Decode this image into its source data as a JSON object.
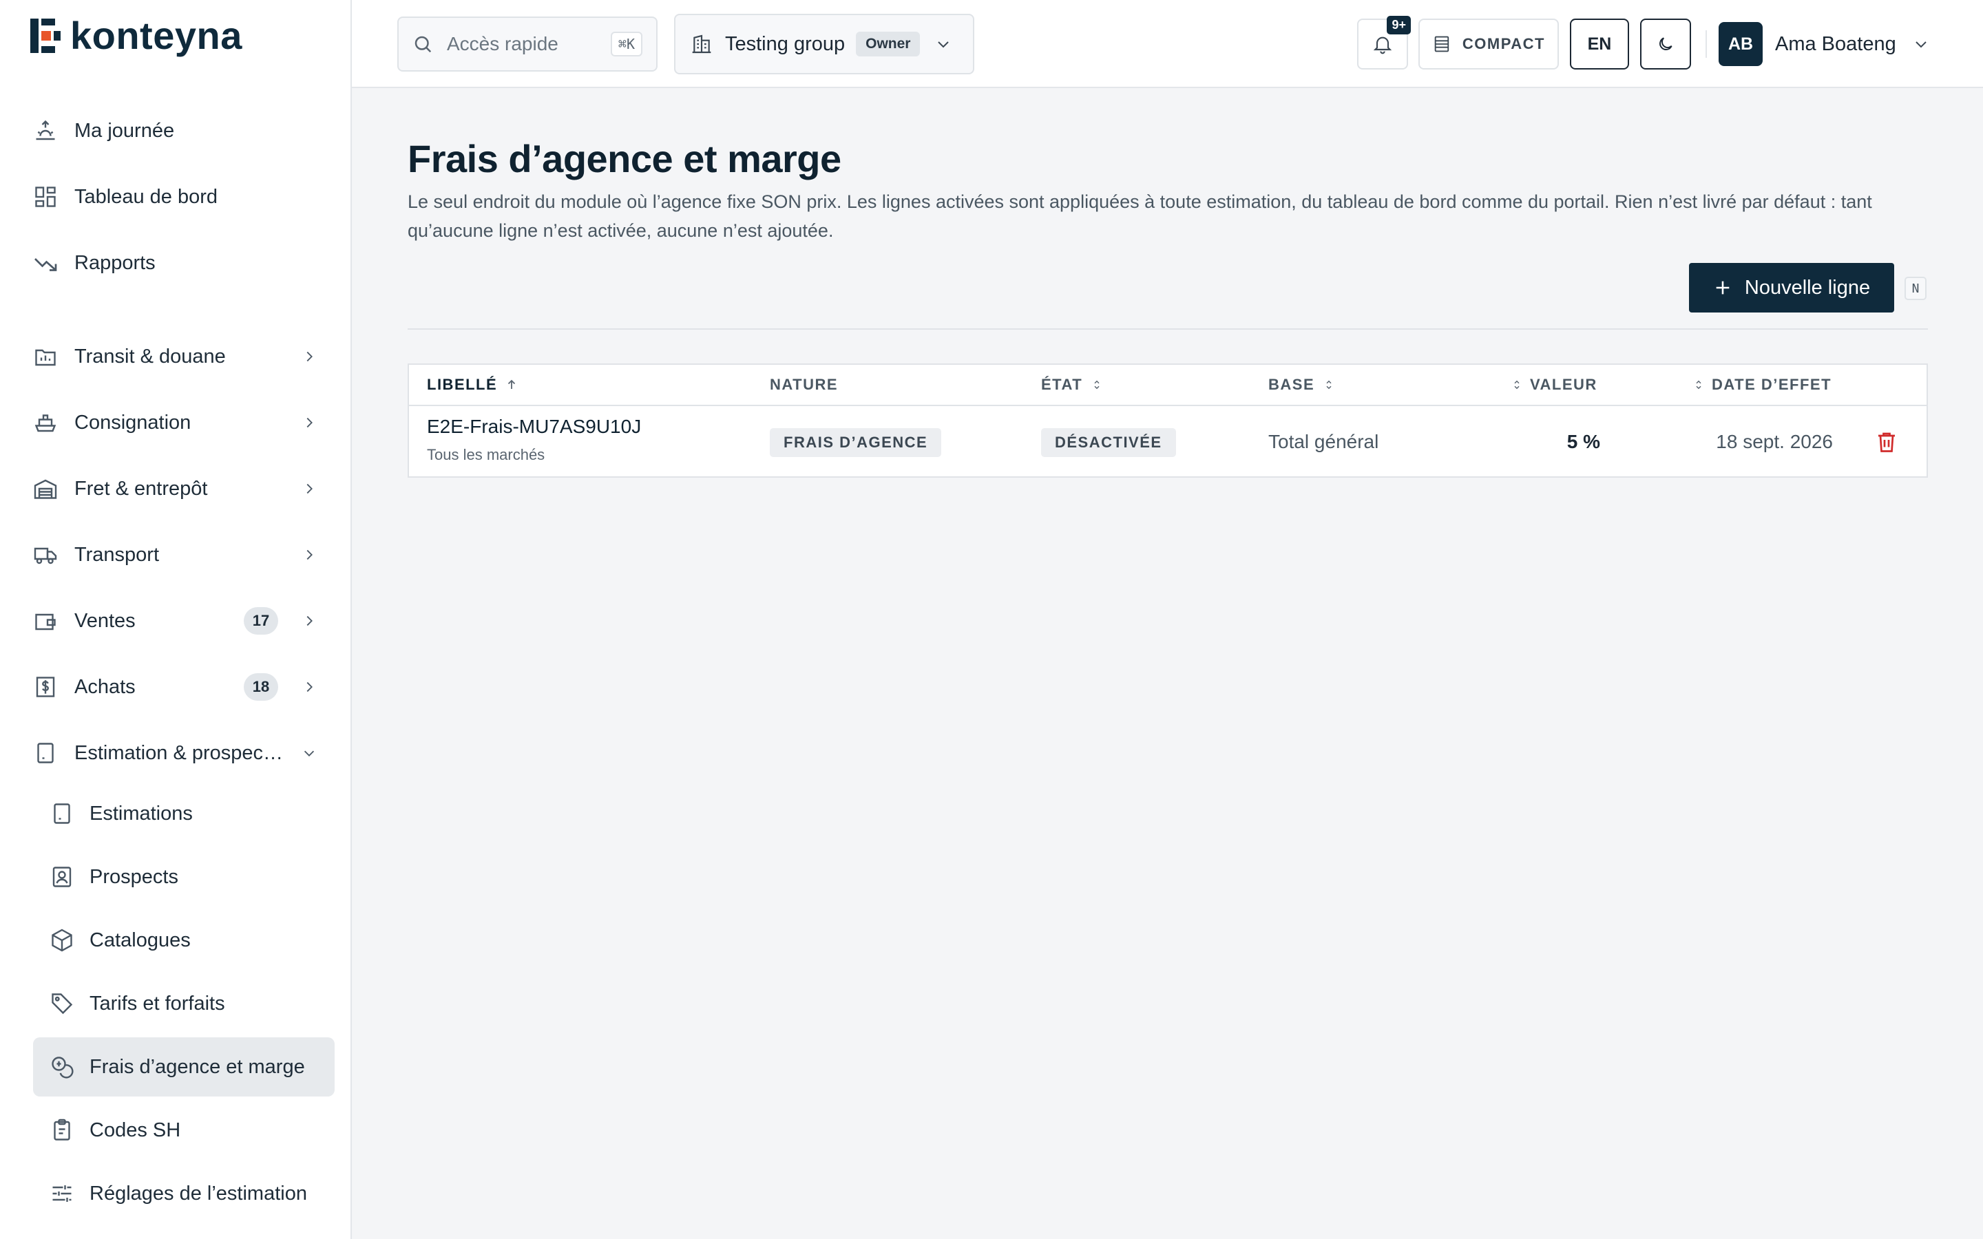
{
  "brand": {
    "name": "konteyna",
    "accent": "#e8562a",
    "dark": "#0f2a3c"
  },
  "sidebar": {
    "primary": [
      {
        "label": "Ma journée",
        "icon": "sunrise-icon"
      },
      {
        "label": "Tableau de bord",
        "icon": "dashboard-grid-icon"
      },
      {
        "label": "Rapports",
        "icon": "trending-down-icon"
      }
    ],
    "modules": [
      {
        "label": "Transit & douane",
        "icon": "folder-customs-icon",
        "badge": null
      },
      {
        "label": "Consignation",
        "icon": "ship-icon",
        "badge": null
      },
      {
        "label": "Fret & entrepôt",
        "icon": "warehouse-icon",
        "badge": null
      },
      {
        "label": "Transport",
        "icon": "truck-icon",
        "badge": null
      },
      {
        "label": "Ventes",
        "icon": "wallet-icon",
        "badge": "17"
      },
      {
        "label": "Achats",
        "icon": "dollar-receipt-icon",
        "badge": "18"
      },
      {
        "label": "Estimation & prospec…",
        "icon": "calculator-icon",
        "badge": null,
        "expanded": true
      }
    ],
    "sub_items": [
      {
        "label": "Estimations",
        "icon": "calculator-icon"
      },
      {
        "label": "Prospects",
        "icon": "contact-card-icon"
      },
      {
        "label": "Catalogues",
        "icon": "package-icon"
      },
      {
        "label": "Tarifs et forfaits",
        "icon": "tag-icon"
      },
      {
        "label": "Frais d’agence et marge",
        "icon": "coins-icon",
        "active": true
      },
      {
        "label": "Codes SH",
        "icon": "clipboard-icon"
      },
      {
        "label": "Réglages de l’estimation",
        "icon": "sliders-icon"
      }
    ]
  },
  "topbar": {
    "search_placeholder": "Accès rapide",
    "search_shortcut": "⌘K",
    "group_name": "Testing group",
    "group_role": "Owner",
    "notifications_badge": "9+",
    "compact_label": "COMPACT",
    "language": "EN",
    "user_initials": "AB",
    "user_name": "Ama Boateng"
  },
  "page": {
    "title": "Frais d’agence et marge",
    "description": "Le seul endroit du module où l’agence fixe SON prix. Les lignes activées sont appliquées à toute estimation, du tableau de bord comme du portail. Rien n’est livré par défaut : tant qu’aucune ligne n’est activée, aucune n’est ajoutée.",
    "new_button": "Nouvelle ligne",
    "new_shortcut": "N"
  },
  "table": {
    "columns": [
      "LIBELLÉ",
      "NATURE",
      "ÉTAT",
      "BASE",
      "VALEUR",
      "DATE D’EFFET"
    ],
    "rows": [
      {
        "label": "E2E-Frais-MU7AS9U10J",
        "scope": "Tous les marchés",
        "nature": "FRAIS D’AGENCE",
        "state": "DÉSACTIVÉE",
        "base": "Total général",
        "value": "5 %",
        "effective_date": "18 sept. 2026"
      }
    ]
  }
}
